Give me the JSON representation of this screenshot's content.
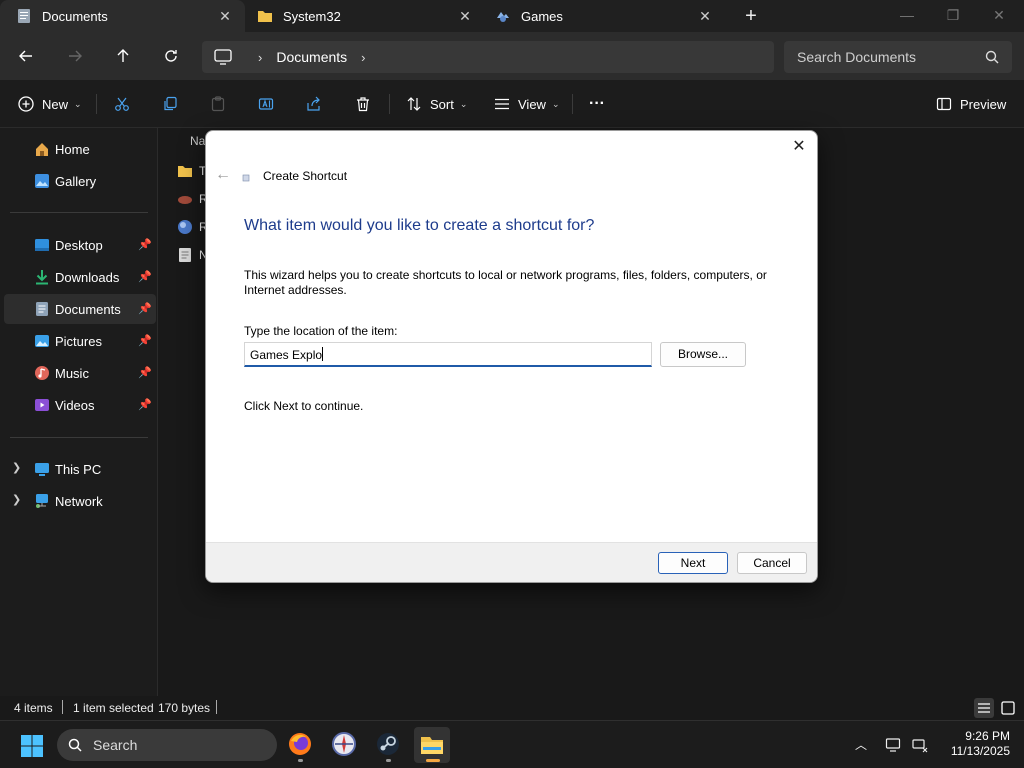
{
  "tabs": [
    {
      "title": "Documents",
      "active": true
    },
    {
      "title": "System32",
      "active": false
    },
    {
      "title": "Games",
      "active": false
    }
  ],
  "window_controls": {
    "minimize": "—",
    "maximize": "❐",
    "close": "✕"
  },
  "nav": {
    "back_icon": "arrow-left-icon",
    "forward_icon": "arrow-right-icon",
    "up_icon": "arrow-up-icon",
    "refresh_icon": "refresh-icon",
    "breadcrumb": [
      "Documents"
    ],
    "search_placeholder": "Search Documents"
  },
  "commands": {
    "new_label": "New",
    "sort_label": "Sort",
    "view_label": "View",
    "more_label": "···",
    "preview_label": "Preview"
  },
  "sidebar": {
    "quick": [
      {
        "label": "Home",
        "icon": "home-icon",
        "color": "#e8a84a"
      },
      {
        "label": "Gallery",
        "icon": "gallery-icon",
        "color": "#3d8fe0"
      }
    ],
    "pinned": [
      {
        "label": "Desktop",
        "icon": "desktop-icon",
        "color": "#2f8fde"
      },
      {
        "label": "Downloads",
        "icon": "downloads-icon",
        "color": "#2bb673"
      },
      {
        "label": "Documents",
        "icon": "documents-icon",
        "color": "#8fa3b8",
        "selected": true
      },
      {
        "label": "Pictures",
        "icon": "pictures-icon",
        "color": "#3aa0e8"
      },
      {
        "label": "Music",
        "icon": "music-icon",
        "color": "#e0665a"
      },
      {
        "label": "Videos",
        "icon": "videos-icon",
        "color": "#8b4fd6"
      }
    ],
    "locations": [
      {
        "label": "This PC",
        "icon": "this-pc-icon",
        "color": "#3aa0e8"
      },
      {
        "label": "Network",
        "icon": "network-icon",
        "color": "#3aa0e8"
      }
    ]
  },
  "content": {
    "column_header": "Na",
    "rows": [
      {
        "name": "T",
        "icon": "folder-icon",
        "color": "#f0c14b"
      },
      {
        "name": "R",
        "icon": "file-icon",
        "color": "#a04a3a"
      },
      {
        "name": "R",
        "icon": "globe-icon",
        "color": "#4a78c8"
      },
      {
        "name": "N",
        "icon": "document-icon",
        "color": "#d8d8d8"
      }
    ]
  },
  "status": {
    "items": "4 items",
    "selection": "1 item selected",
    "size": "170 bytes"
  },
  "dialog": {
    "title": "Create Shortcut",
    "heading": "What item would you like to create a shortcut for?",
    "description": "This wizard helps you to create shortcuts to local or network programs, files, folders, computers, or Internet addresses.",
    "location_label": "Type the location of the item:",
    "location_value": "Games Explo",
    "browse_label": "Browse...",
    "hint": "Click Next to continue.",
    "next_label": "Next",
    "cancel_label": "Cancel"
  },
  "taskbar": {
    "search_label": "Search",
    "apps": [
      {
        "name": "firefox-icon",
        "active": false
      },
      {
        "name": "games-app-icon",
        "active": false
      },
      {
        "name": "steam-icon",
        "active": false
      },
      {
        "name": "file-explorer-icon",
        "active": true
      }
    ],
    "time": "9:26 PM",
    "date": "11/13/2025"
  }
}
